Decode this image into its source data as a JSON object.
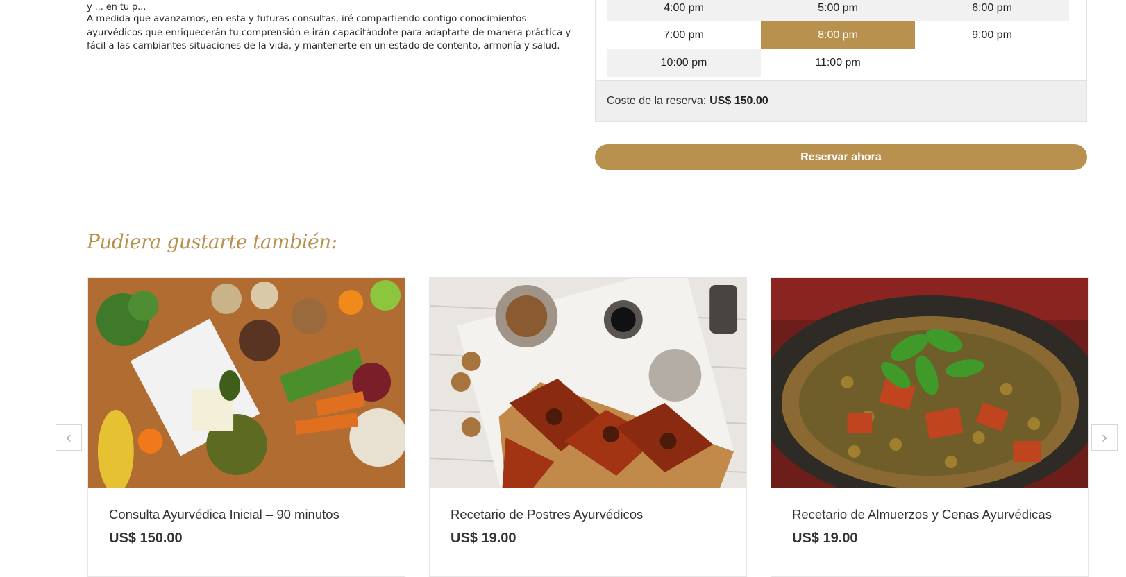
{
  "description": {
    "cut_line": "y ... en tu p...",
    "paragraph": "A medida que avanzamos, en esta y futuras consultas, iré compartiendo contigo conocimientos ayurvédicos que enriquecerán tu comprensión e irán capacitándote para adaptarte de manera práctica y fácil a las cambiantes situaciones de la vida, y mantenerte en un estado de contento, armonía y salud."
  },
  "booking": {
    "slots": [
      {
        "label": "4:00 pm",
        "state": "gray"
      },
      {
        "label": "5:00 pm",
        "state": "gray"
      },
      {
        "label": "6:00 pm",
        "state": "gray"
      },
      {
        "label": "7:00 pm",
        "state": "normal"
      },
      {
        "label": "8:00 pm",
        "state": "selected"
      },
      {
        "label": "9:00 pm",
        "state": "normal"
      },
      {
        "label": "10:00 pm",
        "state": "gray"
      },
      {
        "label": "11:00 pm",
        "state": "normal"
      }
    ],
    "cost_label": "Coste de la reserva:",
    "cost_value": "US$ 150.00",
    "reserve_button": "Reservar ahora"
  },
  "related": {
    "title": "Pudiera gustarte también:",
    "items": [
      {
        "title": "Consulta Ayurvédica Inicial – 90 minutos",
        "price": "US$ 150.00",
        "image": "vegetables-flatlay"
      },
      {
        "title": "Recetario de Postres Ayurvédicos",
        "price": "US$ 19.00",
        "image": "baklava-dessert"
      },
      {
        "title": "Recetario de Almuerzos y Cenas Ayurvédicas",
        "price": "US$ 19.00",
        "image": "lentil-stew"
      }
    ],
    "prev_icon": "chevron-left-icon",
    "next_icon": "chevron-right-icon"
  },
  "colors": {
    "accent": "#b8914f",
    "gray_slot": "#f1f1f1",
    "cost_bg": "#efefef"
  }
}
